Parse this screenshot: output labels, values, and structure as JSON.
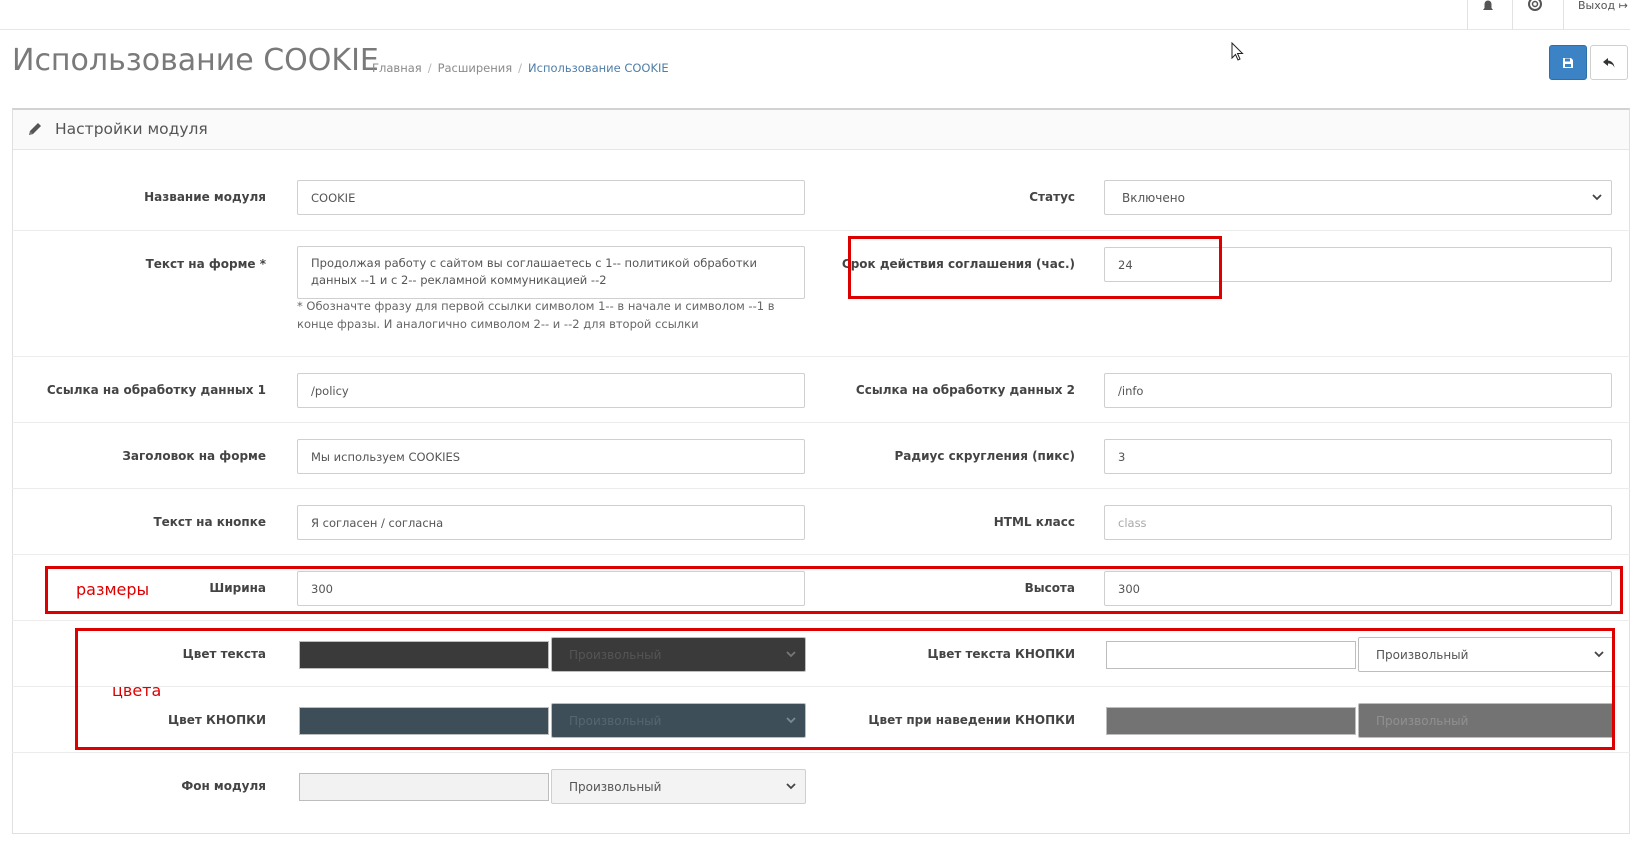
{
  "header": {
    "logout_label": "Выход"
  },
  "page": {
    "title": "Использование COOKIE",
    "breadcrumb": [
      "Главная",
      "Расширения",
      "Использование COOKIE"
    ]
  },
  "panel": {
    "title": "Настройки модуля"
  },
  "fields": {
    "module_name": {
      "label": "Название модуля",
      "value": "COOKIE"
    },
    "status": {
      "label": "Статус",
      "value": "Включено"
    },
    "form_text": {
      "label": "Текст на форме *",
      "value": "Продолжая работу с сайтом вы соглашаетесь с 1--  политикой обработки данных --1 и с 2-- рекламной коммуникацией --2",
      "help": "* Обозначте фразу для первой ссылки символом 1-- в начале и символом --1 в конце фразы. И аналогично символом 2-- и --2 для второй ссылки"
    },
    "agreement_term": {
      "label": "Срок действия соглашения (час.)",
      "value": "24"
    },
    "link1": {
      "label": "Ссылка на обработку данных 1",
      "value": "/policy"
    },
    "link2": {
      "label": "Ссылка на обработку данных 2",
      "value": "/info"
    },
    "form_heading": {
      "label": "Заголовок на форме",
      "value": "Мы используем COOKIES"
    },
    "radius": {
      "label": "Радиус скругления (пикс)",
      "value": "3"
    },
    "button_text": {
      "label": "Текст на кнопке",
      "value": "Я согласен / согласна"
    },
    "html_class": {
      "label": "HTML класс",
      "placeholder": "class"
    },
    "width": {
      "label": "Ширина",
      "value": "300"
    },
    "height": {
      "label": "Высота",
      "value": "300"
    },
    "text_color": {
      "label": "Цвет текста",
      "option": "Произвольный",
      "color": "#3a3a3a"
    },
    "button_text_color": {
      "label": "Цвет текста КНОПКИ",
      "option": "Произвольный",
      "color": "#ffffff"
    },
    "button_color": {
      "label": "Цвет КНОПКИ",
      "option": "Произвольный",
      "color": "#3d4e58"
    },
    "button_hover_color": {
      "label": "Цвет при наведении КНОПКИ",
      "option": "Произвольный",
      "color": "#737373"
    },
    "module_bg": {
      "label": "Фон модуля",
      "option": "Произвольный",
      "color": "#f2f2f2"
    }
  },
  "annotations": {
    "sizes": "размеры",
    "colors": "цвета"
  },
  "colors": {
    "accent": "#3b83c4",
    "annotation_red": "#dd0000"
  }
}
